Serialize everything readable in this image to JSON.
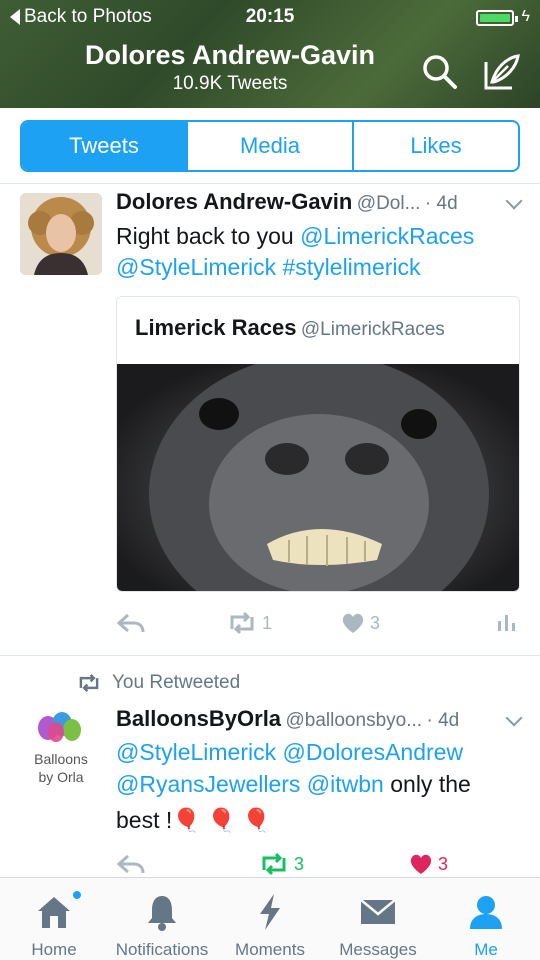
{
  "status_bar": {
    "back_label": "Back to Photos",
    "time": "20:15"
  },
  "header": {
    "name": "Dolores Andrew-Gavin",
    "tweet_count": "10.9K Tweets"
  },
  "tabs": [
    {
      "label": "Tweets",
      "active": true
    },
    {
      "label": "Media",
      "active": false
    },
    {
      "label": "Likes",
      "active": false
    }
  ],
  "tweets": [
    {
      "name": "Dolores Andrew-Gavin",
      "handle": "@Dol...",
      "time": "· 4d",
      "text_line1_plain": "Right back to you ",
      "text_line1_link": "@LimerickRaces",
      "text_line2_link": "@StyleLimerick #stylelimerick",
      "quoted": {
        "name": "Limerick Races",
        "handle": "@LimerickRaces"
      },
      "retweets": "1",
      "likes": "3"
    },
    {
      "context": "You Retweeted",
      "name": "BalloonsByOrla",
      "handle": "@balloonsbyo...",
      "time": "· 4d",
      "avatar_text_1": "Balloons",
      "avatar_text_2": "by Orla",
      "line1_link": "@StyleLimerick @DoloresAndrew",
      "line2_link": "@RyansJewellers @itwbn",
      "line2_plain": " only the",
      "line3_plain": "best ! ",
      "emoji": "🎈 🎈 🎈",
      "retweets": "3",
      "likes": "3"
    }
  ],
  "tabbar": [
    {
      "label": "Home",
      "icon": "home-icon"
    },
    {
      "label": "Notifications",
      "icon": "bell-icon"
    },
    {
      "label": "Moments",
      "icon": "lightning-icon"
    },
    {
      "label": "Messages",
      "icon": "envelope-icon"
    },
    {
      "label": "Me",
      "icon": "person-icon",
      "active": true
    }
  ],
  "colors": {
    "accent": "#1da1f2",
    "retweet_green": "#17bf63",
    "like_red": "#e0245e"
  }
}
